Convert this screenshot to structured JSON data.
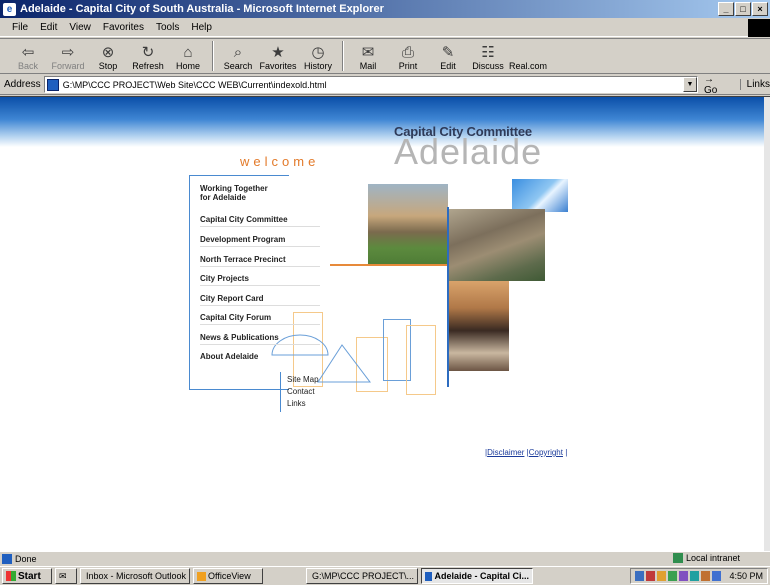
{
  "window": {
    "title": "Adelaide - Capital City of South Australia - Microsoft Internet Explorer",
    "controls": [
      "_",
      "□",
      "×"
    ]
  },
  "menubar": [
    "File",
    "Edit",
    "View",
    "Favorites",
    "Tools",
    "Help"
  ],
  "toolbar": [
    {
      "label": "Back",
      "icon": "⇦",
      "name": "back",
      "disabled": true
    },
    {
      "label": "Forward",
      "icon": "⇨",
      "name": "forward",
      "disabled": true
    },
    {
      "label": "Stop",
      "icon": "⊗",
      "name": "stop"
    },
    {
      "label": "Refresh",
      "icon": "↻",
      "name": "refresh"
    },
    {
      "label": "Home",
      "icon": "⌂",
      "name": "home"
    },
    {
      "label": "Search",
      "icon": "⌕",
      "name": "search"
    },
    {
      "label": "Favorites",
      "icon": "★",
      "name": "favorites"
    },
    {
      "label": "History",
      "icon": "◷",
      "name": "history"
    },
    {
      "label": "Mail",
      "icon": "✉",
      "name": "mail"
    },
    {
      "label": "Print",
      "icon": "⎙",
      "name": "print"
    },
    {
      "label": "Edit",
      "icon": "✎",
      "name": "edit"
    },
    {
      "label": "Discuss",
      "icon": "☷",
      "name": "discuss"
    },
    {
      "label": "Real.com",
      "icon": "",
      "name": "real-com"
    }
  ],
  "address": {
    "label": "Address",
    "value": "G:\\MP\\CCC PROJECT\\Web Site\\CCC WEB\\Current\\indexold.html",
    "go": "Go",
    "links": "Links"
  },
  "page": {
    "org": "Capital City Committee",
    "city": "Adelaide",
    "welcome": "welcome",
    "nav": [
      "Working Together\nfor Adelaide",
      "Capital City Committee",
      "Development Program",
      "North Terrace Precinct",
      "City Projects",
      "City Report Card",
      "Capital City Forum",
      "News & Publications",
      "About Adelaide"
    ],
    "subnav": [
      "Site Map",
      "Contact",
      "Links"
    ],
    "footer": {
      "disclaimer": "Disclaimer",
      "copyright": "Copyright"
    }
  },
  "status": {
    "text": "Done",
    "zone": "Local intranet"
  },
  "taskbar": {
    "start": "Start",
    "tasks": [
      {
        "label": "Inbox - Microsoft Outlook",
        "active": false
      },
      {
        "label": "OfficeView",
        "active": false
      },
      {
        "label": "G:\\MP\\CCC PROJECT\\...",
        "active": false
      },
      {
        "label": "Adelaide - Capital Ci...",
        "active": true
      }
    ],
    "clock": "4:50 PM"
  },
  "colors": {
    "accent_orange": "#e37a2a",
    "accent_blue": "#2d6cc0"
  }
}
